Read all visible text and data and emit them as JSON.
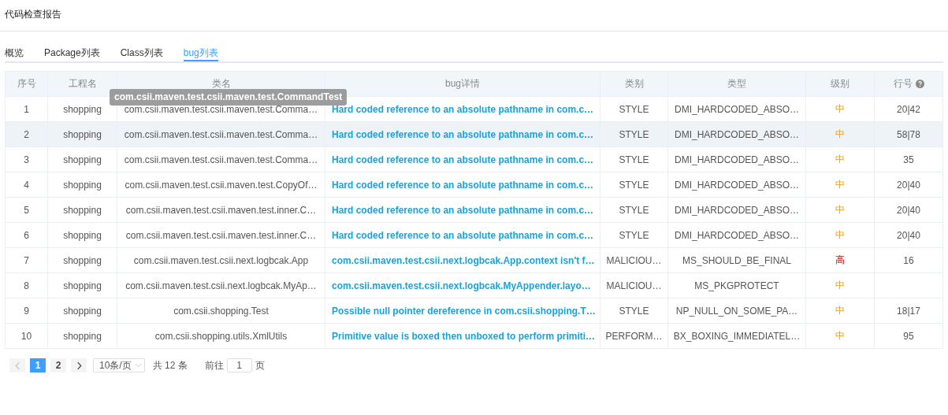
{
  "page_title": "代码检查报告",
  "tabs": [
    {
      "label": "概览",
      "selected": false
    },
    {
      "label": "Package列表",
      "selected": false
    },
    {
      "label": "Class列表",
      "selected": false
    },
    {
      "label": "bug列表",
      "selected": true
    }
  ],
  "table": {
    "columns": [
      {
        "label": "序号",
        "help": false
      },
      {
        "label": "工程名",
        "help": false
      },
      {
        "label": "类名",
        "help": false
      },
      {
        "label": "bug详情",
        "help": false
      },
      {
        "label": "类别",
        "help": false
      },
      {
        "label": "类型",
        "help": false
      },
      {
        "label": "级别",
        "help": false
      },
      {
        "label": "行号",
        "help": true
      }
    ],
    "rows": [
      {
        "index": "1",
        "project": "shopping",
        "class_name": "com.csii.maven.test.csii.maven.test.Comma…",
        "detail": "Hard coded reference to an absolute pathname in com.c…",
        "category": "STYLE",
        "type": "DMI_HARDCODED_ABSO…",
        "severity": "中",
        "kind": "medium",
        "line": "20|42",
        "hovered": false
      },
      {
        "index": "2",
        "project": "shopping",
        "class_name": "com.csii.maven.test.csii.maven.test.Comma…",
        "detail": "Hard coded reference to an absolute pathname in com.c…",
        "category": "STYLE",
        "type": "DMI_HARDCODED_ABSO…",
        "severity": "中",
        "kind": "medium",
        "line": "58|78",
        "hovered": true
      },
      {
        "index": "3",
        "project": "shopping",
        "class_name": "com.csii.maven.test.csii.maven.test.Comma…",
        "detail": "Hard coded reference to an absolute pathname in com.c…",
        "category": "STYLE",
        "type": "DMI_HARDCODED_ABSO…",
        "severity": "中",
        "kind": "medium",
        "line": "35",
        "hovered": false
      },
      {
        "index": "4",
        "project": "shopping",
        "class_name": "com.csii.maven.test.csii.maven.test.CopyOf…",
        "detail": "Hard coded reference to an absolute pathname in com.c…",
        "category": "STYLE",
        "type": "DMI_HARDCODED_ABSO…",
        "severity": "中",
        "kind": "medium",
        "line": "20|40",
        "hovered": false
      },
      {
        "index": "5",
        "project": "shopping",
        "class_name": "com.csii.maven.test.csii.maven.test.inner.C…",
        "detail": "Hard coded reference to an absolute pathname in com.c…",
        "category": "STYLE",
        "type": "DMI_HARDCODED_ABSO…",
        "severity": "中",
        "kind": "medium",
        "line": "20|40",
        "hovered": false
      },
      {
        "index": "6",
        "project": "shopping",
        "class_name": "com.csii.maven.test.csii.maven.test.inner.C…",
        "detail": "Hard coded reference to an absolute pathname in com.c…",
        "category": "STYLE",
        "type": "DMI_HARDCODED_ABSO…",
        "severity": "中",
        "kind": "medium",
        "line": "20|40",
        "hovered": false
      },
      {
        "index": "7",
        "project": "shopping",
        "class_name": "com.csii.maven.test.csii.next.logbcak.App",
        "detail": "com.csii.maven.test.csii.next.logbcak.App.context isn't f…",
        "category": "MALICIOU…",
        "type": "MS_SHOULD_BE_FINAL",
        "severity": "高",
        "kind": "high",
        "line": "16",
        "hovered": false
      },
      {
        "index": "8",
        "project": "shopping",
        "class_name": "com.csii.maven.test.csii.next.logbcak.MyAp…",
        "detail": "com.csii.maven.test.csii.next.logbcak.MyAppender.layo…",
        "category": "MALICIOU…",
        "type": "MS_PKGPROTECT",
        "severity": "中",
        "kind": "medium",
        "hovered": false
      },
      {
        "index": "9",
        "project": "shopping",
        "class_name": "com.csii.shopping.Test",
        "detail": "Possible null pointer dereference in com.csii.shopping.T…",
        "category": "STYLE",
        "type": "NP_NULL_ON_SOME_PA…",
        "severity": "中",
        "kind": "medium",
        "line": "18|17",
        "hovered": false
      },
      {
        "index": "10",
        "project": "shopping",
        "class_name": "com.csii.shopping.utils.XmlUtils",
        "detail": "Primitive value is boxed then unboxed to perform primiti…",
        "category": "PERFORM…",
        "type": "BX_BOXING_IMMEDIATEL…",
        "severity": "中",
        "kind": "medium",
        "line": "95",
        "hovered": false
      }
    ]
  },
  "tooltip": {
    "text": "com.csii.maven.test.csii.maven.test.CommandTest"
  },
  "pagination": {
    "prev_disabled": true,
    "pages": [
      {
        "label": "1",
        "selected": true
      },
      {
        "label": "2",
        "selected": false
      }
    ],
    "next_disabled": false,
    "page_size": "10条/页",
    "total": "共 12 条",
    "goto_label": "前往",
    "goto_value": "1",
    "goto_suffix": "页"
  }
}
